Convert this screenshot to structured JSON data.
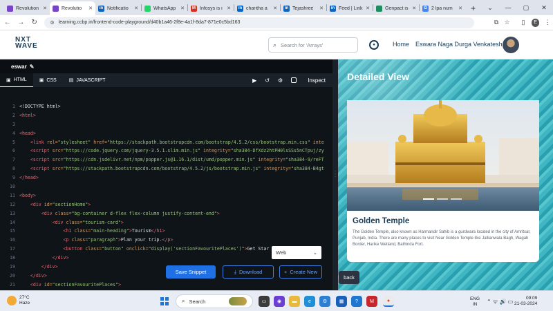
{
  "browser": {
    "tabs": [
      {
        "label": "Revolution",
        "favicon_color": "#7a44c9",
        "favicon_text": "",
        "active": false
      },
      {
        "label": "Revolutio",
        "favicon_color": "#7a44c9",
        "favicon_text": "",
        "active": true
      },
      {
        "label": "Notificatio",
        "favicon_color": "#0a66c2",
        "favicon_text": "in",
        "active": false
      },
      {
        "label": "WhatsApp",
        "favicon_color": "#25d366",
        "favicon_text": "",
        "active": false
      },
      {
        "label": "Infosys is i",
        "favicon_color": "#d93025",
        "favicon_text": "M",
        "active": false
      },
      {
        "label": "charitha a",
        "favicon_color": "#0a66c2",
        "favicon_text": "in",
        "active": false
      },
      {
        "label": "Tejashree",
        "favicon_color": "#0a66c2",
        "favicon_text": "in",
        "active": false
      },
      {
        "label": "Feed | Link",
        "favicon_color": "#0a66c2",
        "favicon_text": "in",
        "active": false
      },
      {
        "label": "Genpact is",
        "favicon_color": "#1d8c5e",
        "favicon_text": "",
        "active": false
      },
      {
        "label": "2 lpa num",
        "favicon_color": "#4285f4",
        "favicon_text": "G",
        "active": false
      }
    ],
    "new_tab": "+",
    "url": "learning.ccbp.in/frontend-code-playground/d40b1a46-2f8e-4a1f-8da7-871e0c5bd163",
    "profile_initial": "E"
  },
  "header": {
    "logo_top": "NXT",
    "logo_bottom": "WAVE",
    "search_placeholder": "Search for 'Arrays'",
    "home_label": "Home",
    "user_name": "Eswara Naga Durga Venkatesh"
  },
  "editor": {
    "project_name": "eswar",
    "tabs": [
      "HTML",
      "CSS",
      "JAVASCRIPT"
    ],
    "inspect_label": "Inspect",
    "code_lines": [
      {
        "n": "1",
        "parts": [
          [
            "t-txt",
            "<!DOCTYPE html>"
          ]
        ]
      },
      {
        "n": "2",
        "parts": [
          [
            "t-tag",
            "<html>"
          ]
        ]
      },
      {
        "n": "3",
        "parts": []
      },
      {
        "n": "4",
        "parts": [
          [
            "t-tag",
            "<head>"
          ]
        ]
      },
      {
        "n": "5",
        "parts": [
          [
            "t-tag",
            "    <link "
          ],
          [
            "t-attr",
            "rel="
          ],
          [
            "t-str",
            "\"stylesheet\" "
          ],
          [
            "t-attr",
            "href="
          ],
          [
            "t-str",
            "\"https://stackpath.bootstrapcdn.com/bootstrap/4.5.2/css/bootstrap.min.css\" "
          ],
          [
            "t-attr",
            "inte"
          ]
        ]
      },
      {
        "n": "6",
        "parts": [
          [
            "t-tag",
            "    <script "
          ],
          [
            "t-attr",
            "src="
          ],
          [
            "t-str",
            "\"https://code.jquery.com/jquery-3.5.1.slim.min.js\" "
          ],
          [
            "t-attr",
            "integrity="
          ],
          [
            "t-str",
            "\"sha384-DfXdz2htPH0lsSSs5nCTpuj/zy"
          ]
        ]
      },
      {
        "n": "7",
        "parts": [
          [
            "t-tag",
            "    <script "
          ],
          [
            "t-attr",
            "src="
          ],
          [
            "t-str",
            "\"https://cdn.jsdelivr.net/npm/popper.js@1.16.1/dist/umd/popper.min.js\" "
          ],
          [
            "t-attr",
            "integrity="
          ],
          [
            "t-str",
            "\"sha384-9/reFT"
          ]
        ]
      },
      {
        "n": "8",
        "parts": [
          [
            "t-tag",
            "    <script "
          ],
          [
            "t-attr",
            "src="
          ],
          [
            "t-str",
            "\"https://stackpath.bootstrapcdn.com/bootstrap/4.5.2/js/bootstrap.min.js\" "
          ],
          [
            "t-attr",
            "integrity="
          ],
          [
            "t-str",
            "\"sha384-B4gt"
          ]
        ]
      },
      {
        "n": "9",
        "parts": [
          [
            "t-tag",
            "</head>"
          ]
        ]
      },
      {
        "n": "10",
        "parts": []
      },
      {
        "n": "11",
        "parts": [
          [
            "t-tag",
            "<body>"
          ]
        ]
      },
      {
        "n": "12",
        "parts": [
          [
            "t-tag",
            "    <div "
          ],
          [
            "t-attr",
            "id="
          ],
          [
            "t-str",
            "\"sectionHome\""
          ],
          [
            "t-tag",
            ">"
          ]
        ]
      },
      {
        "n": "13",
        "parts": [
          [
            "t-tag",
            "        <div "
          ],
          [
            "t-attr",
            "class="
          ],
          [
            "t-str",
            "\"bg-container d-flex flex-column justify-content-end\""
          ],
          [
            "t-tag",
            ">"
          ]
        ]
      },
      {
        "n": "14",
        "parts": [
          [
            "t-tag",
            "            <div "
          ],
          [
            "t-attr",
            "class="
          ],
          [
            "t-str",
            "\"tourism-card\""
          ],
          [
            "t-tag",
            ">"
          ]
        ]
      },
      {
        "n": "15",
        "parts": [
          [
            "t-tag",
            "                <h1 "
          ],
          [
            "t-attr",
            "class="
          ],
          [
            "t-str",
            "\"main-heading\""
          ],
          [
            "t-tag",
            ">"
          ],
          [
            "t-txt",
            "Tourism"
          ],
          [
            "t-tag",
            "</h1>"
          ]
        ]
      },
      {
        "n": "16",
        "parts": [
          [
            "t-tag",
            "                <p "
          ],
          [
            "t-attr",
            "class="
          ],
          [
            "t-str",
            "\"paragraph\""
          ],
          [
            "t-tag",
            ">"
          ],
          [
            "t-txt",
            "Plan your trip."
          ],
          [
            "t-tag",
            "</p>"
          ]
        ]
      },
      {
        "n": "17",
        "parts": [
          [
            "t-tag",
            "                <button "
          ],
          [
            "t-attr",
            "class="
          ],
          [
            "t-str",
            "\"button\" "
          ],
          [
            "t-attr",
            "onclick="
          ],
          [
            "t-str",
            "\"display('sectionFavouritePlaces')\""
          ],
          [
            "t-tag",
            ">"
          ],
          [
            "t-txt",
            "Get Star"
          ]
        ]
      },
      {
        "n": "18",
        "parts": [
          [
            "t-tag",
            "            </div>"
          ]
        ]
      },
      {
        "n": "19",
        "parts": [
          [
            "t-tag",
            "        </div>"
          ]
        ]
      },
      {
        "n": "20",
        "parts": [
          [
            "t-tag",
            "    </div>"
          ]
        ]
      },
      {
        "n": "21",
        "parts": [
          [
            "t-tag",
            "    <div "
          ],
          [
            "t-attr",
            "id="
          ],
          [
            "t-str",
            "\"sectionFavouritePlaces\""
          ],
          [
            "t-tag",
            ">"
          ]
        ]
      }
    ],
    "select_value": "Web",
    "save_label": "Save Snippet",
    "download_label": "Download",
    "create_label": "Create New"
  },
  "preview": {
    "title": "Detailed View",
    "card_title": "Golden Temple",
    "card_desc": "The Golden Temple, also known as Harmandir Sahib is a gurdwara located in the city of Amritsar, Punjab, India. There are many places to visit Near Golden Temple like Jallianwala Bagh, Wagah Border, Harike Wetland, Bathinda Fort.",
    "back_label": "back"
  },
  "taskbar": {
    "temp": "27°C",
    "weather": "Haze",
    "search_label": "Search",
    "lang1": "ENG",
    "lang2": "IN",
    "time": "09:09",
    "date": "21-03-2024"
  }
}
